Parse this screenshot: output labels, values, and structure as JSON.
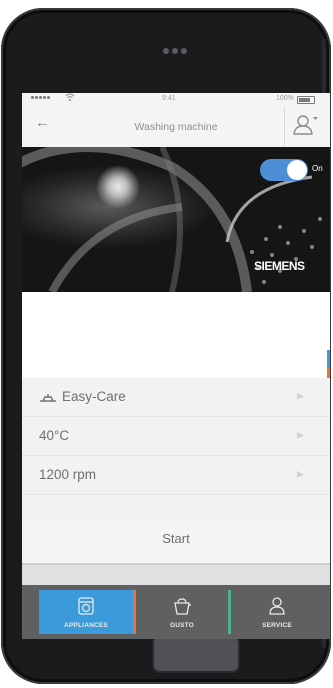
{
  "status_bar": {
    "time": "9:41",
    "battery": "100%"
  },
  "header": {
    "title": "Washing machine"
  },
  "hero": {
    "toggle_label": "On",
    "toggle_on": true,
    "brand": "SIEMENS"
  },
  "settings": [
    {
      "label": "Easy-Care",
      "icon": "shirt-care-icon"
    },
    {
      "label": "40°C"
    },
    {
      "label": "1200 rpm"
    }
  ],
  "start_label": "Start",
  "tabs": [
    {
      "label": "APPLIANCES",
      "icon": "appliance-icon",
      "active": true
    },
    {
      "label": "GUSTO",
      "icon": "cooking-icon",
      "active": false
    },
    {
      "label": "SERVICE",
      "icon": "service-person-icon",
      "active": false
    }
  ],
  "colors": {
    "accent": "#3b9ad9",
    "tabbar": "#5f6062",
    "gusto_marker": "#e0763a",
    "service_marker": "#4db385"
  }
}
